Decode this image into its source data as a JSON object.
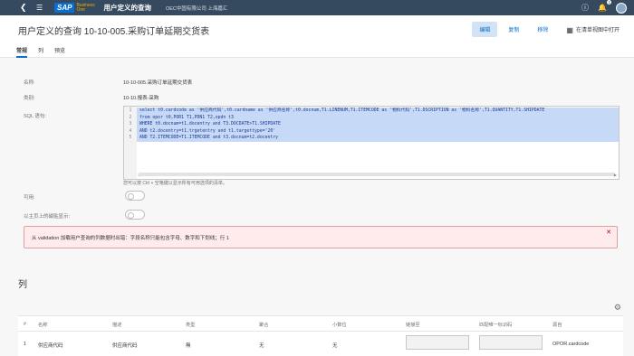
{
  "shell": {
    "brand": "SAP",
    "brand_sub": "Business One",
    "app_title": "用户定义的查询",
    "company": "OEC中国有限公司 上海嘉汇",
    "notification_count": "1"
  },
  "header": {
    "title": "用户定义的查询 10-10-005.采购订单延期交货表",
    "edit_label": "编辑",
    "copy_label": "复制",
    "delete_label": "移除",
    "open_list_label": "在清单视图中打开",
    "tabs": [
      "常规",
      "列",
      "预览"
    ]
  },
  "form": {
    "name_label": "名称:",
    "name_value": "10-10-005.采购订单延期交货表",
    "category_label": "类别:",
    "category_value": "10-10.报表-采购",
    "sql_label": "SQL 语句:",
    "sql_lines": [
      {
        "num": "1",
        "text": "select t0.cardcode as '供应商代码',t0.cardname as '供应商名称',t0.docnum,T1.LINENUM,T1.ITEMCODE as '物料代码',T1.DSCRIPTION as '物料名称',T1.QUANTITY,T1.SHIPDATE"
      },
      {
        "num": "2",
        "text": "from opor t0,POR1 T1,PDN1 T2,opdn t3"
      },
      {
        "num": "3",
        "text": "WHERE   t0.docnum=t1.docentry and T3.DOCDATE>T1.SHIPDATE"
      },
      {
        "num": "4",
        "text": "AND t2.docentry=t1.trgetentry and t1.targettype='20'"
      },
      {
        "num": "5",
        "text": "AND T2.ITEMCODE=T1.ITEMCODE and t3.docnum=t2.docentry"
      }
    ],
    "sql_hint": "您可以按 Ctrl + 空格键以显示所有可用选项的清单。",
    "enable_label": "可用:",
    "homepage_label": "以主页上的磁贴显示:",
    "error_message": "从 validation 加载用户查询的列数据时出错：字段名称只能包含字母、数字和下划线；行 1"
  },
  "columns": {
    "section_title": "列",
    "headers": [
      "#",
      "名称",
      "描述",
      "类型",
      "聚合",
      "小数位",
      "链接至",
      "匹配唯一标识码",
      "源自"
    ],
    "rows": [
      {
        "index": "1",
        "name": "供应商代码",
        "description": "供应商代码",
        "type": "無",
        "aggregate": "无",
        "decimals": "无",
        "source": "OPOR.cardcode"
      }
    ]
  },
  "colors": {
    "shell_bg": "#354a5f",
    "accent": "#0a6ed1",
    "sql_highlight": "#c6d9f6",
    "error_bg": "#ffebeb"
  },
  "icons": [
    "back-icon",
    "menu-icon",
    "help-icon",
    "bell-icon",
    "avatar",
    "grid-icon",
    "close-icon",
    "settings-icon"
  ]
}
